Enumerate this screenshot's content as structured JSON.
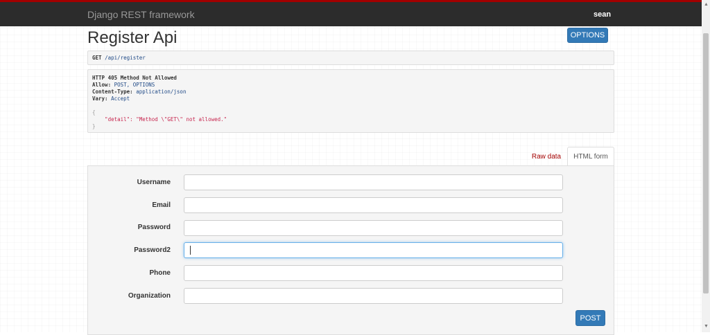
{
  "navbar": {
    "brand": "Django REST framework",
    "user": "sean"
  },
  "page": {
    "title": "Register Api",
    "options_button": "OPTIONS"
  },
  "request": {
    "method": "GET",
    "path": "/api/register"
  },
  "response": {
    "status_line": "HTTP 405 Method Not Allowed",
    "allow_key": "Allow:",
    "allow_value": "POST, OPTIONS",
    "content_type_key": "Content-Type:",
    "content_type_value": "application/json",
    "vary_key": "Vary:",
    "vary_value": "Accept",
    "open_brace": "{",
    "detail_line": "    \"detail\": \"Method \\\"GET\\\" not allowed.\"",
    "close_brace": "}"
  },
  "tabs": {
    "raw": "Raw data",
    "html": "HTML form"
  },
  "form": {
    "fields": [
      {
        "label": "Username",
        "value": ""
      },
      {
        "label": "Email",
        "value": ""
      },
      {
        "label": "Password",
        "value": ""
      },
      {
        "label": "Password2",
        "value": ""
      },
      {
        "label": "Phone",
        "value": ""
      },
      {
        "label": "Organization",
        "value": ""
      }
    ],
    "submit": "POST"
  },
  "colors": {
    "accent": "#a30000",
    "navbar_bg": "#2c2c2c",
    "button": "#337ab7"
  },
  "icons": {
    "scroll_up": "triangle-up-icon",
    "scroll_down": "triangle-down-icon"
  }
}
